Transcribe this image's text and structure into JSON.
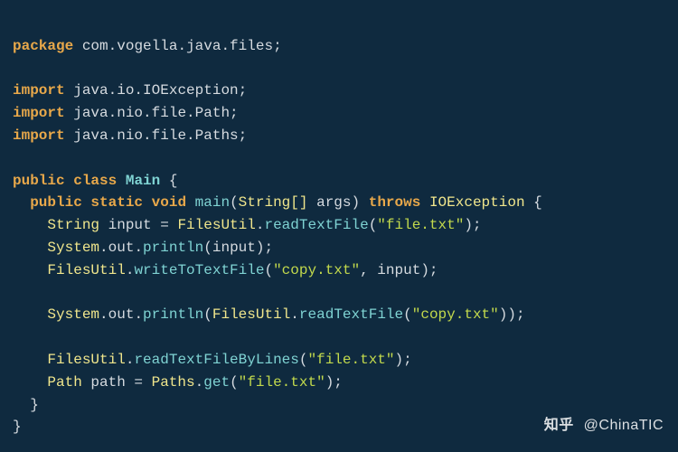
{
  "code": {
    "line1": {
      "kw": "package",
      "pkg": "com.vogella.java.files",
      "semi": ";"
    },
    "blank1": "",
    "line3": {
      "kw": "import",
      "pkg": "java.io.IOException",
      "semi": ";"
    },
    "line4": {
      "kw": "import",
      "pkg": "java.nio.file.Path",
      "semi": ";"
    },
    "line5": {
      "kw": "import",
      "pkg": "java.nio.file.Paths",
      "semi": ";"
    },
    "blank2": "",
    "line7": {
      "kw1": "public",
      "kw2": "class",
      "cls": "Main",
      "brace": " {"
    },
    "line8": {
      "indent": "  ",
      "kw1": "public",
      "kw2": "static",
      "kw3": "void",
      "method": "main",
      "paren_open": "(",
      "argtype": "String[]",
      "argname": " args",
      "paren_close": ")",
      "kw4": "throws",
      "exc": "IOException",
      "brace": " {"
    },
    "line9": {
      "indent": "    ",
      "type": "String",
      "var": " input = ",
      "cls": "FilesUtil",
      "dot": ".",
      "method": "readTextFile",
      "paren_open": "(",
      "str": "\"file.txt\"",
      "paren_close_semi": ");"
    },
    "line10": {
      "indent": "    ",
      "cls": "System",
      "dot1": ".",
      "field": "out",
      "dot2": ".",
      "method": "println",
      "paren_open": "(",
      "arg": "input",
      "paren_close_semi": ");"
    },
    "line11": {
      "indent": "    ",
      "cls": "FilesUtil",
      "dot": ".",
      "method": "writeToTextFile",
      "paren_open": "(",
      "str1": "\"copy.txt\"",
      "comma_sp": ", ",
      "arg2": "input",
      "paren_close_semi": ");"
    },
    "blank3": "",
    "line13": {
      "indent": "    ",
      "cls": "System",
      "dot1": ".",
      "field": "out",
      "dot2": ".",
      "method": "println",
      "paren_open": "(",
      "cls2": "FilesUtil",
      "dot3": ".",
      "method2": "readTextFile",
      "paren2_open": "(",
      "str": "\"copy.txt\"",
      "paren2_close": ")",
      "paren_close_semi": ");"
    },
    "blank4": "",
    "line15": {
      "indent": "    ",
      "cls": "FilesUtil",
      "dot": ".",
      "method": "readTextFileByLines",
      "paren_open": "(",
      "str": "\"file.txt\"",
      "paren_close_semi": ");"
    },
    "line16": {
      "indent": "    ",
      "type": "Path",
      "var": " path = ",
      "cls": "Paths",
      "dot": ".",
      "method": "get",
      "paren_open": "(",
      "str": "\"file.txt\"",
      "paren_close_semi": ");"
    },
    "line17": {
      "indent": "  ",
      "brace": "}"
    },
    "line18": {
      "brace": "}"
    }
  },
  "watermark": {
    "logo": "知乎",
    "at": " @ChinaTIC"
  }
}
